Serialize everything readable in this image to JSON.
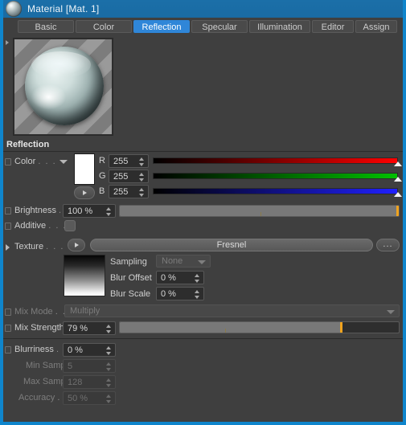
{
  "window": {
    "title": "Material [Mat. 1]",
    "icon": "material-sphere-icon",
    "accent_color": "#0f85cc",
    "background_color": "#3f3f3f"
  },
  "tabs": [
    {
      "label": "Basic",
      "active": false
    },
    {
      "label": "Color",
      "active": false
    },
    {
      "label": "Reflection",
      "active": true
    },
    {
      "label": "Specular",
      "active": false
    },
    {
      "label": "Illumination",
      "active": false
    },
    {
      "label": "Editor",
      "active": false
    },
    {
      "label": "Assign",
      "active": false
    }
  ],
  "group": {
    "title": "Reflection"
  },
  "color": {
    "label": "Color",
    "dots": ". . .",
    "swatch_hex": "#ffffff",
    "channels": [
      {
        "name": "R",
        "value": "255",
        "gradient_to": "#ff0000"
      },
      {
        "name": "G",
        "value": "255",
        "gradient_to": "#00c000"
      },
      {
        "name": "B",
        "value": "255",
        "gradient_to": "#2020ff"
      }
    ]
  },
  "brightness": {
    "label": "Brightness",
    "dots": ". .",
    "value": "100 %",
    "percent": 100
  },
  "additive": {
    "label": "Additive",
    "dots": ". . . .",
    "checked": false
  },
  "texture": {
    "label": "Texture",
    "dots": ". . . .",
    "value": "Fresnel",
    "browse_label": "...",
    "sampling": {
      "label": "Sampling",
      "value": "None",
      "enabled": false
    },
    "blur_offset": {
      "label": "Blur Offset",
      "value": "0 %"
    },
    "blur_scale": {
      "label": "Blur Scale",
      "value": "0 %"
    }
  },
  "mix_mode": {
    "label": "Mix Mode",
    "dots": ". . .",
    "value": "Multiply",
    "enabled": false
  },
  "mix_strength": {
    "label": "Mix Strength",
    "value": "79 %",
    "percent": 79
  },
  "blurriness": {
    "label": "Blurriness",
    "dots": ". . . .",
    "value": "0 %"
  },
  "min_samples": {
    "label": "Min Samples",
    "value": "5",
    "enabled": false
  },
  "max_samples": {
    "label": "Max Samples",
    "value": "128",
    "enabled": false
  },
  "accuracy": {
    "label": "Accuracy",
    "dots": ". . . .",
    "value": "50 %",
    "enabled": false
  }
}
